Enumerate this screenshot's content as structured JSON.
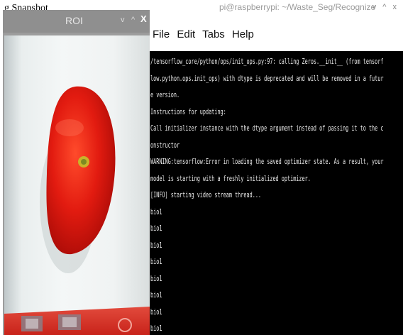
{
  "page": {
    "top_left_label": "g Snapshot"
  },
  "roi_window": {
    "title": "ROI",
    "controls": {
      "minimize": "v",
      "maximize": "^",
      "close": "X"
    }
  },
  "terminal_window": {
    "title": "pi@raspberrypi: ~/Waste_Seg/Recognize",
    "controls": "v ^ x",
    "menu": [
      "File",
      "Edit",
      "Tabs",
      "Help"
    ],
    "lines": [
      "/tensorflow_core/python/ops/init_ops.py:97: calling Zeros.__init__ (from tensorf",
      "low.python.ops.init_ops) with dtype is deprecated and will be removed in a futur",
      "e version.",
      "Instructions for updating:",
      "Call initializer instance with the dtype argument instead of passing it to the c",
      "onstructor",
      "WARNING:tensorflow:Error in loading the saved optimizer state. As a result, your",
      " model is starting with a freshly initialized optimizer.",
      "[INFO] starting video stream thread...",
      "bio1",
      "bio1",
      "bio1",
      "bio1",
      "bio1",
      "bio1",
      "bio1",
      "bio1"
    ]
  }
}
